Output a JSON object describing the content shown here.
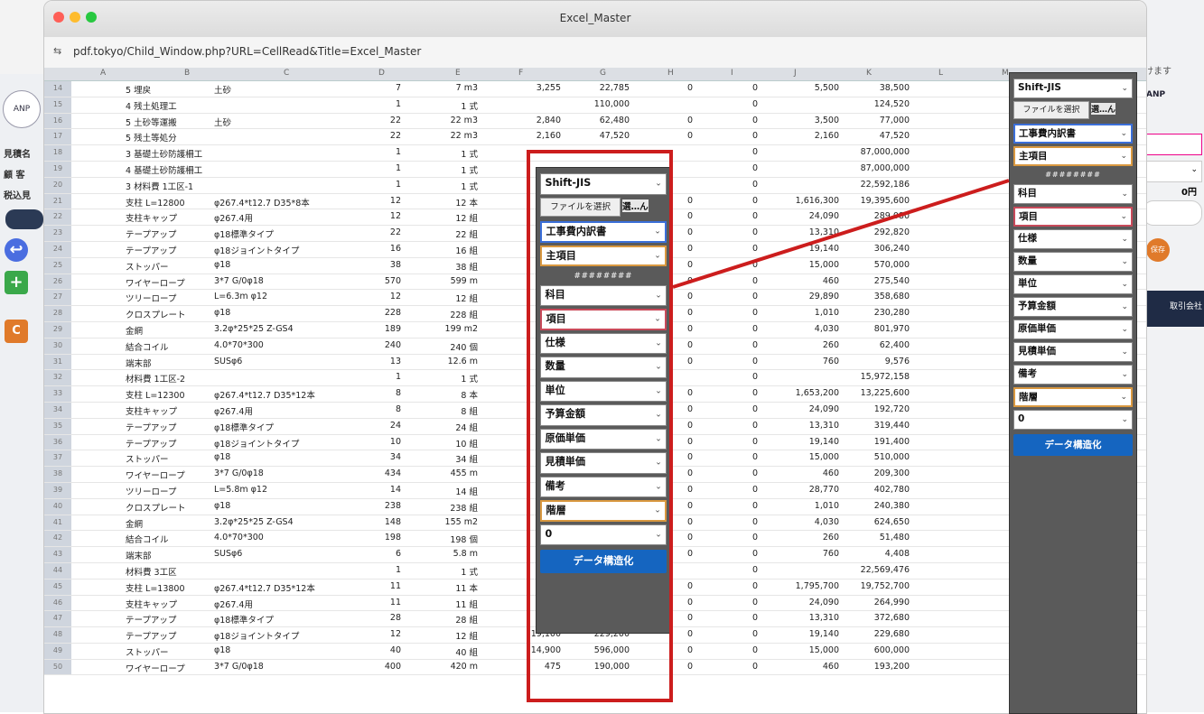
{
  "window": {
    "title": "Excel_Master",
    "url": "pdf.tokyo/Child_Window.php?URL=CellRead&Title=Excel_Master"
  },
  "sidebar": {
    "labels": [
      "見積名",
      "顧 客",
      "税込見"
    ],
    "logo": "ANP"
  },
  "right_strip": {
    "text_top": "けます",
    "logo": "ANP",
    "zero": "0円",
    "save": "保存",
    "trade": "取引会社"
  },
  "columns": [
    "A",
    "B",
    "C",
    "D",
    "E",
    "F",
    "G",
    "H",
    "I",
    "J",
    "K",
    "L",
    "M"
  ],
  "rows": [
    [
      "14",
      "5 埋戻",
      "土砂",
      "7",
      "7 m3",
      "3,255",
      "22,785",
      "0",
      "0",
      "5,500",
      "38,500"
    ],
    [
      "15",
      "4 残土処理工",
      "",
      "1",
      "1 式",
      "",
      "110,000",
      "",
      "0",
      "",
      "124,520"
    ],
    [
      "16",
      "5 土砂等運搬",
      "土砂",
      "22",
      "22 m3",
      "2,840",
      "62,480",
      "0",
      "0",
      "3,500",
      "77,000"
    ],
    [
      "17",
      "5 残土等処分",
      "",
      "22",
      "22 m3",
      "2,160",
      "47,520",
      "0",
      "0",
      "2,160",
      "47,520"
    ],
    [
      "18",
      "3 基礎土砂防護柵工",
      "",
      "1",
      "1 式",
      "",
      "",
      "",
      "0",
      "",
      "87,000,000"
    ],
    [
      "19",
      "4 基礎土砂防護柵工",
      "",
      "1",
      "1 式",
      "",
      "",
      "",
      "0",
      "",
      "87,000,000"
    ],
    [
      "20",
      "3 材料費 1工区-1",
      "",
      "1",
      "1 式",
      "",
      "",
      "",
      "0",
      "",
      "22,592,186"
    ],
    [
      "21",
      "支柱 L=12800",
      "φ267.4*t12.7 D35*8本",
      "12",
      "12 本",
      "",
      "",
      "0",
      "0",
      "1,616,300",
      "19,395,600"
    ],
    [
      "22",
      "支柱キャップ",
      "φ267.4用",
      "12",
      "12 組",
      "",
      "",
      "0",
      "0",
      "24,090",
      "289,080"
    ],
    [
      "23",
      "テープアップ",
      "φ18標準タイプ",
      "22",
      "22 組",
      "",
      "",
      "0",
      "0",
      "13,310",
      "292,820"
    ],
    [
      "24",
      "テープアップ",
      "φ18ジョイントタイプ",
      "16",
      "16 組",
      "",
      "",
      "0",
      "0",
      "19,140",
      "306,240"
    ],
    [
      "25",
      "ストッパー",
      "φ18",
      "38",
      "38 組",
      "",
      "",
      "0",
      "0",
      "15,000",
      "570,000"
    ],
    [
      "26",
      "ワイヤーロープ",
      "3*7 G/0φ18",
      "570",
      "599 m",
      "",
      "",
      "0",
      "0",
      "460",
      "275,540"
    ],
    [
      "27",
      "ツリーロープ",
      "L=6.3m φ12",
      "12",
      "12 組",
      "",
      "",
      "0",
      "0",
      "29,890",
      "358,680"
    ],
    [
      "28",
      "クロスプレート",
      "φ18",
      "228",
      "228 組",
      "",
      "",
      "0",
      "0",
      "1,010",
      "230,280"
    ],
    [
      "29",
      "金網",
      "3.2φ*25*25 Z-GS4",
      "189",
      "199 m2",
      "",
      "",
      "0",
      "0",
      "4,030",
      "801,970"
    ],
    [
      "30",
      "結合コイル",
      "4.0*70*300",
      "240",
      "240 個",
      "",
      "",
      "0",
      "0",
      "260",
      "62,400"
    ],
    [
      "31",
      "端末部",
      "SUSφ6",
      "13",
      "12.6 m",
      "",
      "",
      "0",
      "0",
      "760",
      "9,576"
    ],
    [
      "32",
      "材料費 1工区-2",
      "",
      "1",
      "1 式",
      "",
      "",
      "",
      "0",
      "",
      "15,972,158"
    ],
    [
      "33",
      "支柱 L=12300",
      "φ267.4*t12.7 D35*12本",
      "8",
      "8 本",
      "",
      "",
      "0",
      "0",
      "1,653,200",
      "13,225,600"
    ],
    [
      "34",
      "支柱キャップ",
      "φ267.4用",
      "8",
      "8 組",
      "",
      "",
      "0",
      "0",
      "24,090",
      "192,720"
    ],
    [
      "35",
      "テープアップ",
      "φ18標準タイプ",
      "24",
      "24 組",
      "",
      "",
      "0",
      "0",
      "13,310",
      "319,440"
    ],
    [
      "36",
      "テープアップ",
      "φ18ジョイントタイプ",
      "10",
      "10 組",
      "",
      "",
      "0",
      "0",
      "19,140",
      "191,400"
    ],
    [
      "37",
      "ストッパー",
      "φ18",
      "34",
      "34 組",
      "",
      "",
      "0",
      "0",
      "15,000",
      "510,000"
    ],
    [
      "38",
      "ワイヤーロープ",
      "3*7 G/0φ18",
      "434",
      "455 m",
      "",
      "",
      "0",
      "0",
      "460",
      "209,300"
    ],
    [
      "39",
      "ツリーロープ",
      "L=5.8m φ12",
      "14",
      "14 組",
      "",
      "",
      "0",
      "0",
      "28,770",
      "402,780"
    ],
    [
      "40",
      "クロスプレート",
      "φ18",
      "238",
      "238 組",
      "",
      "",
      "0",
      "0",
      "1,010",
      "240,380"
    ],
    [
      "41",
      "金網",
      "3.2φ*25*25 Z-GS4",
      "148",
      "155 m2",
      "",
      "",
      "0",
      "0",
      "4,030",
      "624,650"
    ],
    [
      "42",
      "結合コイル",
      "4.0*70*300",
      "198",
      "198 個",
      "",
      "",
      "0",
      "0",
      "260",
      "51,480"
    ],
    [
      "43",
      "端末部",
      "SUSφ6",
      "6",
      "5.8 m",
      "",
      "",
      "0",
      "0",
      "760",
      "4,408"
    ],
    [
      "44",
      "材料費 3工区",
      "",
      "1",
      "1 式",
      "",
      "",
      "",
      "0",
      "",
      "22,569,476"
    ],
    [
      "45",
      "支柱 L=13800",
      "φ267.4*t12.7 D35*12本",
      "11",
      "11 本",
      "",
      "",
      "0",
      "0",
      "1,795,700",
      "19,752,700"
    ],
    [
      "46",
      "支柱キャップ",
      "φ267.4用",
      "11",
      "11 組",
      "",
      "",
      "0",
      "0",
      "24,090",
      "264,990"
    ],
    [
      "47",
      "テープアップ",
      "φ18標準タイプ",
      "28",
      "28 組",
      "",
      "",
      "0",
      "0",
      "13,310",
      "372,680"
    ],
    [
      "48",
      "テープアップ",
      "φ18ジョイントタイプ",
      "12",
      "12 組",
      "19,100",
      "229,200",
      "0",
      "0",
      "19,140",
      "229,680"
    ],
    [
      "49",
      "ストッパー",
      "φ18",
      "40",
      "40 組",
      "14,900",
      "596,000",
      "0",
      "0",
      "15,000",
      "600,000"
    ],
    [
      "50",
      "ワイヤーロープ",
      "3*7 G/0φ18",
      "400",
      "420 m",
      "475",
      "190,000",
      "0",
      "0",
      "460",
      "193,200"
    ]
  ],
  "panel": {
    "encoding": "Shift-JIS",
    "file_button": "ファイルを選択",
    "file_status": "選…ん",
    "sheet": "工事費内訳書",
    "main_item": "主項目",
    "separator": "########",
    "fields": [
      "科目",
      "項目",
      "仕様",
      "数量",
      "単位",
      "予算金額",
      "原価単価",
      "見積単価",
      "備考",
      "階層"
    ],
    "zero": "0",
    "data_button": "データ構造化"
  }
}
